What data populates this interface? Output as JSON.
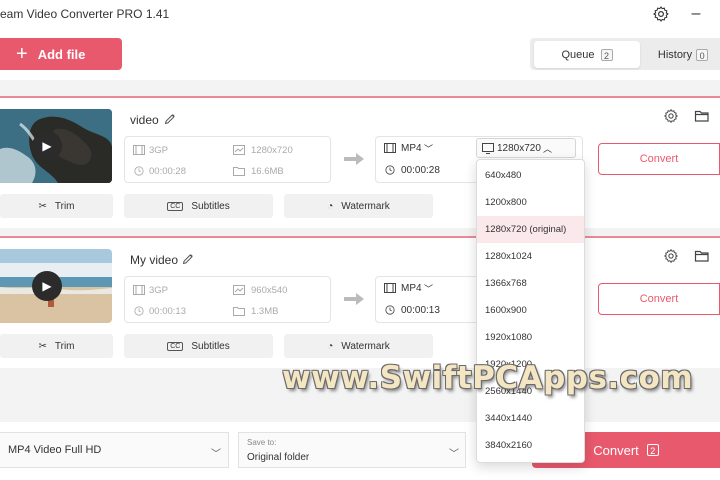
{
  "app": {
    "title": "eam Video Converter PRO 1.41",
    "minimize_glyph": "–"
  },
  "header": {
    "add_file_label": "Add file",
    "tabs": [
      {
        "label": "Queue",
        "count": "2"
      },
      {
        "label": "History",
        "count": "0"
      }
    ]
  },
  "files": [
    {
      "name": "video",
      "input": {
        "format": "3GP",
        "resolution": "1280x720",
        "duration": "00:00:28",
        "size": "16.6MB"
      },
      "output": {
        "format": "MP4",
        "duration": "00:00:28",
        "resolution": "1280x720"
      },
      "convert_label": "Convert",
      "actions": [
        "Trim",
        "Subtitles",
        "Watermark"
      ]
    },
    {
      "name": "My video",
      "input": {
        "format": "3GP",
        "resolution": "960x540",
        "duration": "00:00:13",
        "size": "1.3MB"
      },
      "output": {
        "format": "MP4",
        "duration": "00:00:13"
      },
      "convert_label": "Convert",
      "actions": [
        "Trim",
        "Subtitles",
        "Watermark"
      ]
    }
  ],
  "resolution_dropdown": {
    "selected": "1280x720 (original)",
    "options": [
      "640x480",
      "1200x800",
      "1280x720 (original)",
      "1280x1024",
      "1366x768",
      "1600x900",
      "1920x1080",
      "1920x1200",
      "2560x1440",
      "3440x1440",
      "3840x2160"
    ]
  },
  "bottom": {
    "profile": "MP4 Video Full HD",
    "save_to_label": "Save to:",
    "save_to_value": "Original folder",
    "convert_all_label": "Convert",
    "convert_all_count": "2"
  },
  "watermark_text": "www.SwiftPCApps.com",
  "colors": {
    "accent": "#e9596d",
    "accent_border": "#e88a98",
    "selected_row": "#fbe8eb"
  }
}
